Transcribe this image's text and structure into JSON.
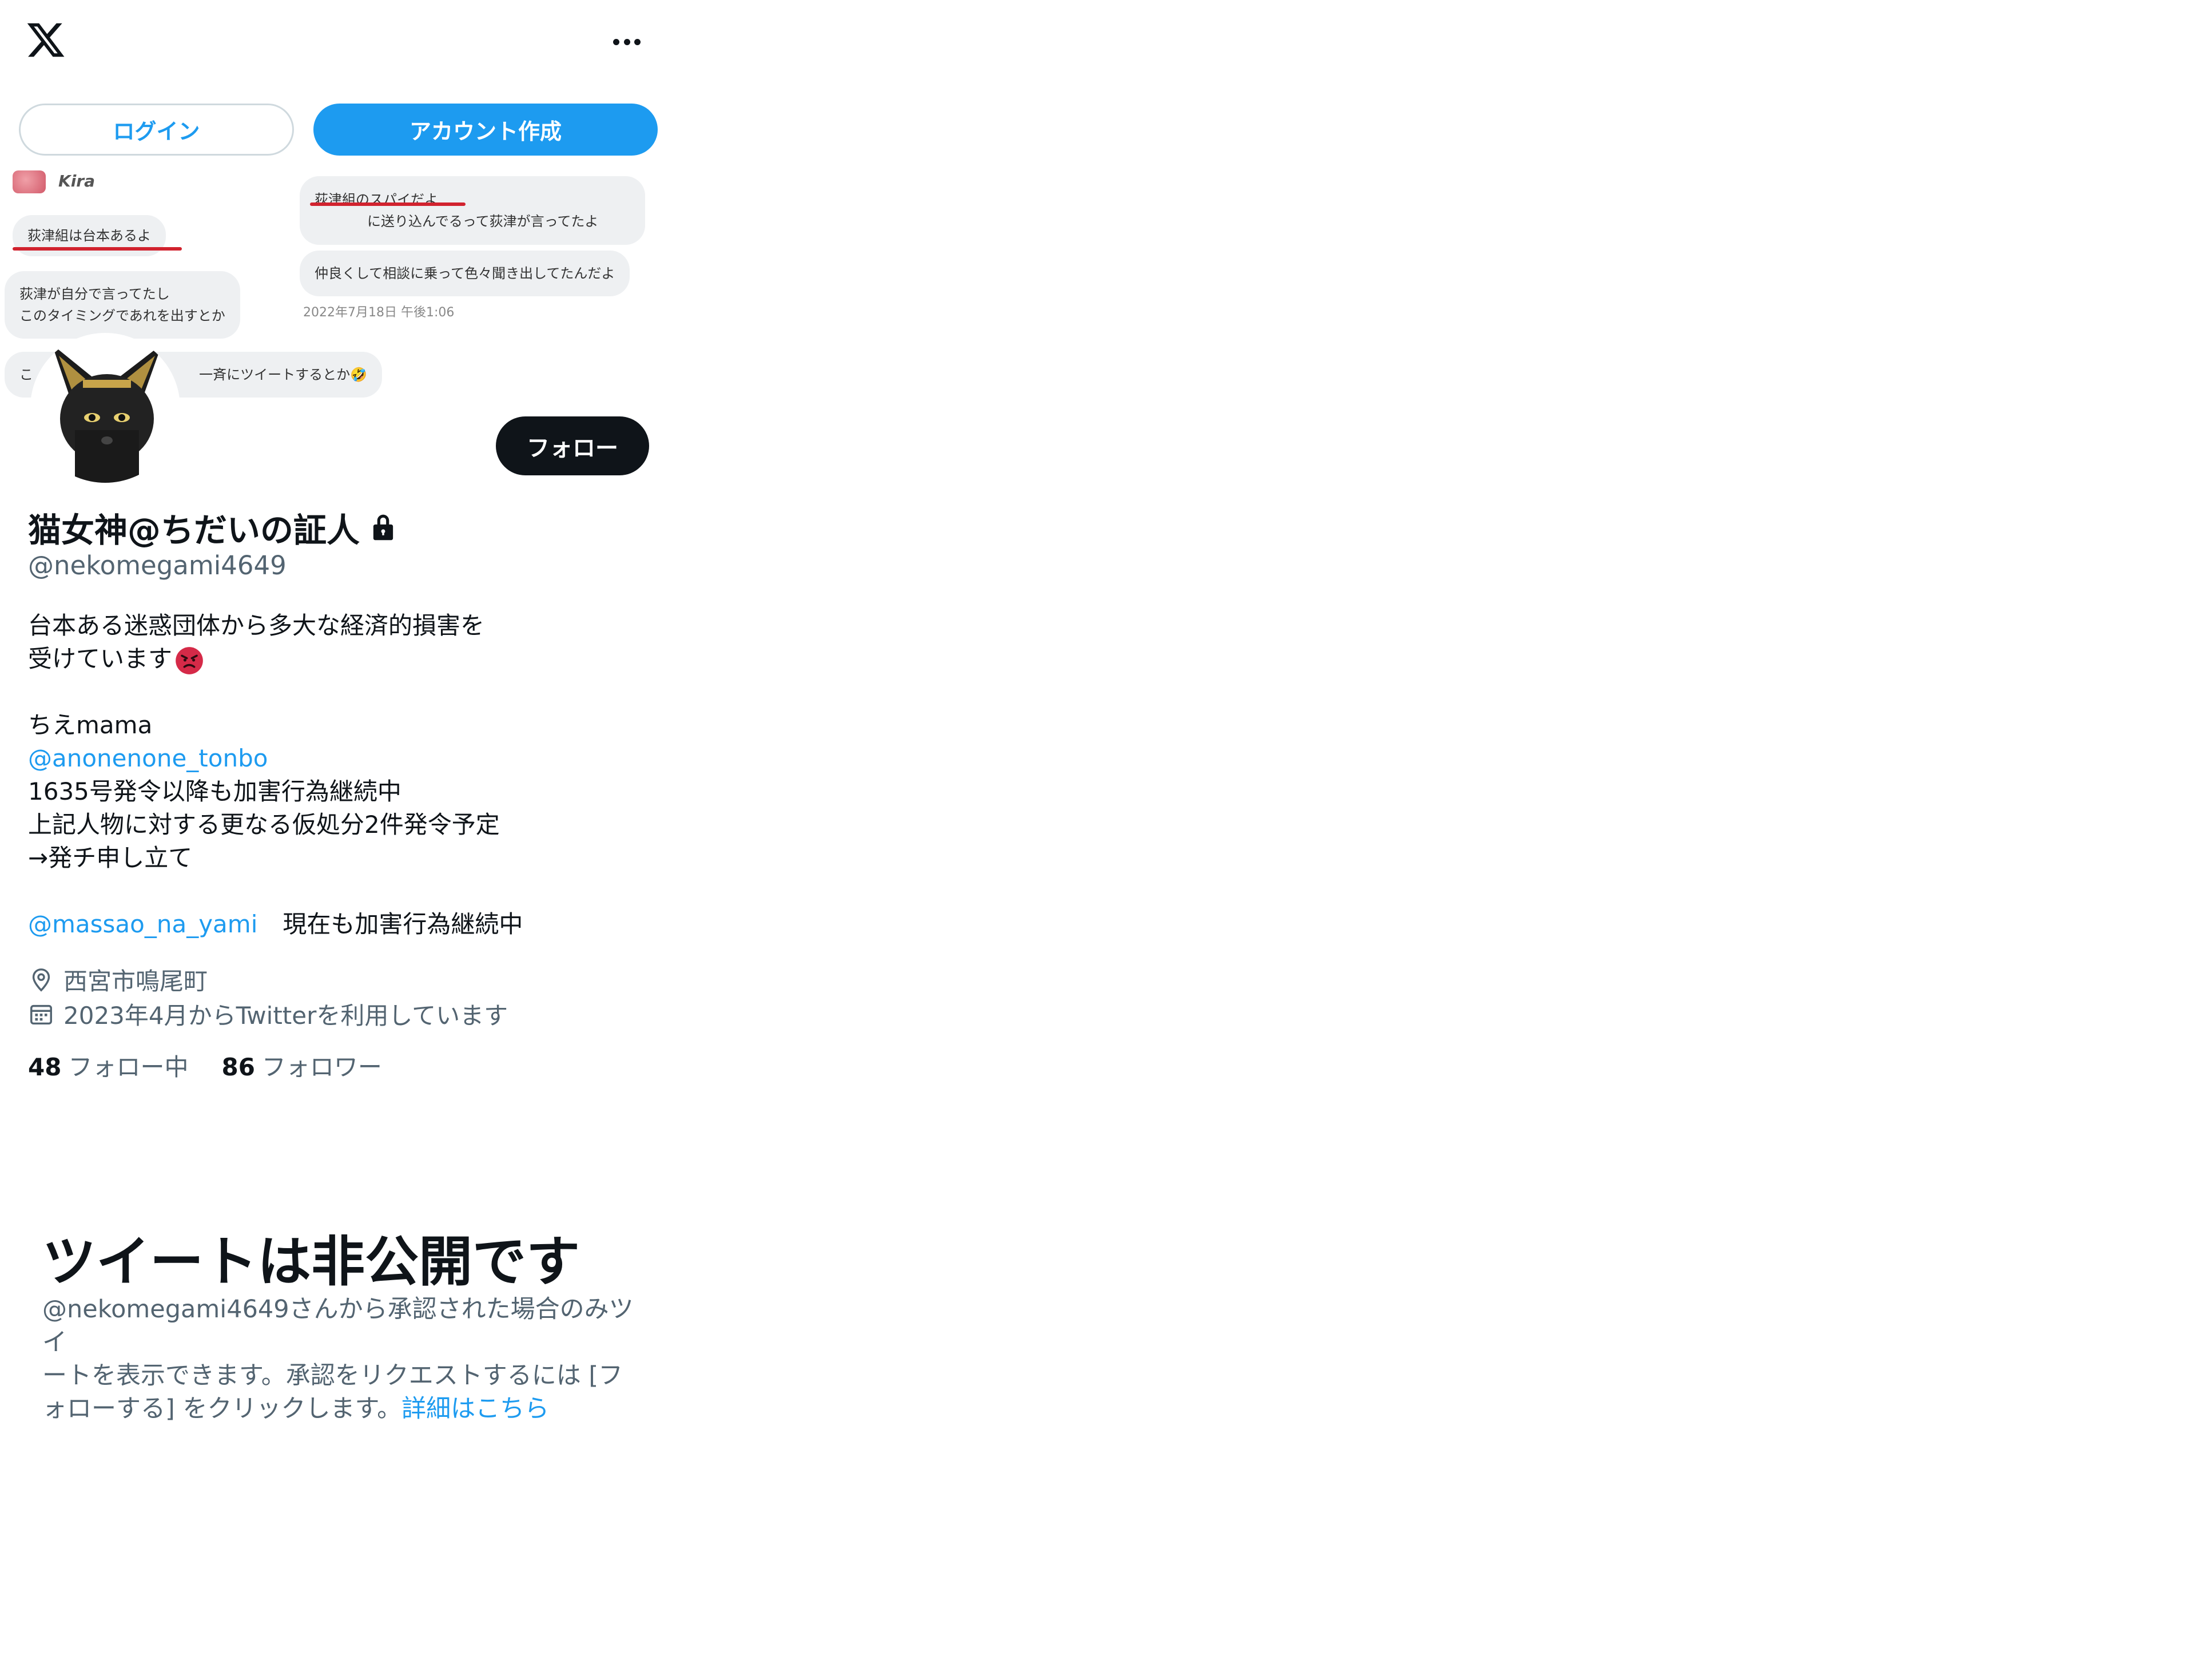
{
  "header": {
    "logo_icon": "x-logo-icon",
    "more_icon": "more-horizontal-icon",
    "login_label": "ログイン",
    "signup_label": "アカウント作成"
  },
  "banner": {
    "kira_name": "Kira",
    "left_bubbles": [
      "荻津組は台本あるよ",
      "荻津が自分で言ってたし",
      "このタイミングであれを出すとか",
      "こ",
      "一斉にツイートするとか🤣"
    ],
    "right_bubbles": [
      "荻津組のスパイだよ",
      "に送り込んでるって荻津が言ってたよ",
      "仲良くして相談に乗って色々聞き出してたんだよ"
    ],
    "date": "2022年7月18日 午後1:06"
  },
  "profile": {
    "follow_label": "フォロー",
    "display_name": "猫女神@ちだいの証人",
    "handle": "@nekomegami4649",
    "bio": {
      "line1": "台本ある迷惑団体から多大な経済的損害を",
      "line2": "受けています",
      "line3": "ちえmama",
      "mention1": "@anonenone_tonbo",
      "line4": "1635号発令以降も加害行為継続中",
      "line5": "上記人物に対する更なる仮処分2件発令予定",
      "line6": "→発チ申し立て",
      "mention2": "@massao_na_yami",
      "line7": "現在も加害行為継続中"
    },
    "location": "西宮市鳴尾町",
    "joined": "2023年4月からTwitterを利用しています",
    "following_count": "48",
    "following_label": "フォロー中",
    "followers_count": "86",
    "followers_label": "フォロワー"
  },
  "private": {
    "title": "ツイートは非公開です",
    "desc_part1": "@nekomegami4649さんから承認された場合のみツイ",
    "desc_part2": "ートを表示できます。承認をリクエストするには [フ",
    "desc_part3": "ォローする] をクリックします。",
    "learn_more": "詳細はこちら"
  },
  "colors": {
    "accent": "#1d9bf0",
    "text": "#0f1419",
    "secondary": "#536471",
    "underline": "#d1222e"
  }
}
